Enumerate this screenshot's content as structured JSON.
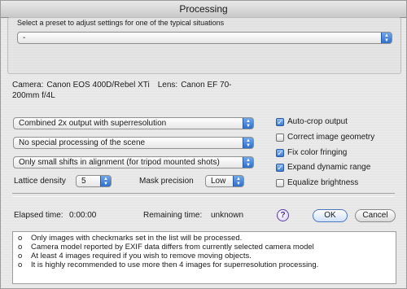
{
  "window": {
    "title": "Processing"
  },
  "preset": {
    "label": "Select a preset to adjust settings for one of the typical situations",
    "value": "-"
  },
  "camera": {
    "camera_label": "Camera:",
    "camera_value": "Canon EOS 400D/Rebel XTi",
    "lens_label": "Lens:",
    "lens_value": "Canon EF 70-200mm f/4L"
  },
  "options": {
    "output_mode": "Combined 2x output with superresolution",
    "scene_processing": "No special processing of the scene",
    "alignment": "Only small shifts in alignment (for tripod mounted shots)",
    "lattice_label": "Lattice density",
    "lattice_value": "5",
    "mask_label": "Mask precision",
    "mask_value": "Low"
  },
  "checkboxes": [
    {
      "label": "Auto-crop output",
      "checked": true
    },
    {
      "label": "Correct image geometry",
      "checked": false
    },
    {
      "label": "Fix color fringing",
      "checked": true
    },
    {
      "label": "Expand dynamic range",
      "checked": true
    },
    {
      "label": "Equalize brightness",
      "checked": false
    }
  ],
  "status": {
    "elapsed_label": "Elapsed time:",
    "elapsed_value": "0:00:00",
    "remaining_label": "Remaining time:",
    "remaining_value": "unknown"
  },
  "buttons": {
    "help": "?",
    "ok": "OK",
    "cancel": "Cancel"
  },
  "messages": [
    {
      "bullet": "o",
      "text": "Only images with checkmarks set in the list will be processed."
    },
    {
      "bullet": "o",
      "text": "Camera model reported by EXIF data differs from currently selected camera model"
    },
    {
      "bullet": "o",
      "text": "At least 4 images required if you wish to remove moving objects."
    },
    {
      "bullet": "o",
      "text": "It is highly recommended to use more then 4 images for superresolution processing."
    }
  ]
}
